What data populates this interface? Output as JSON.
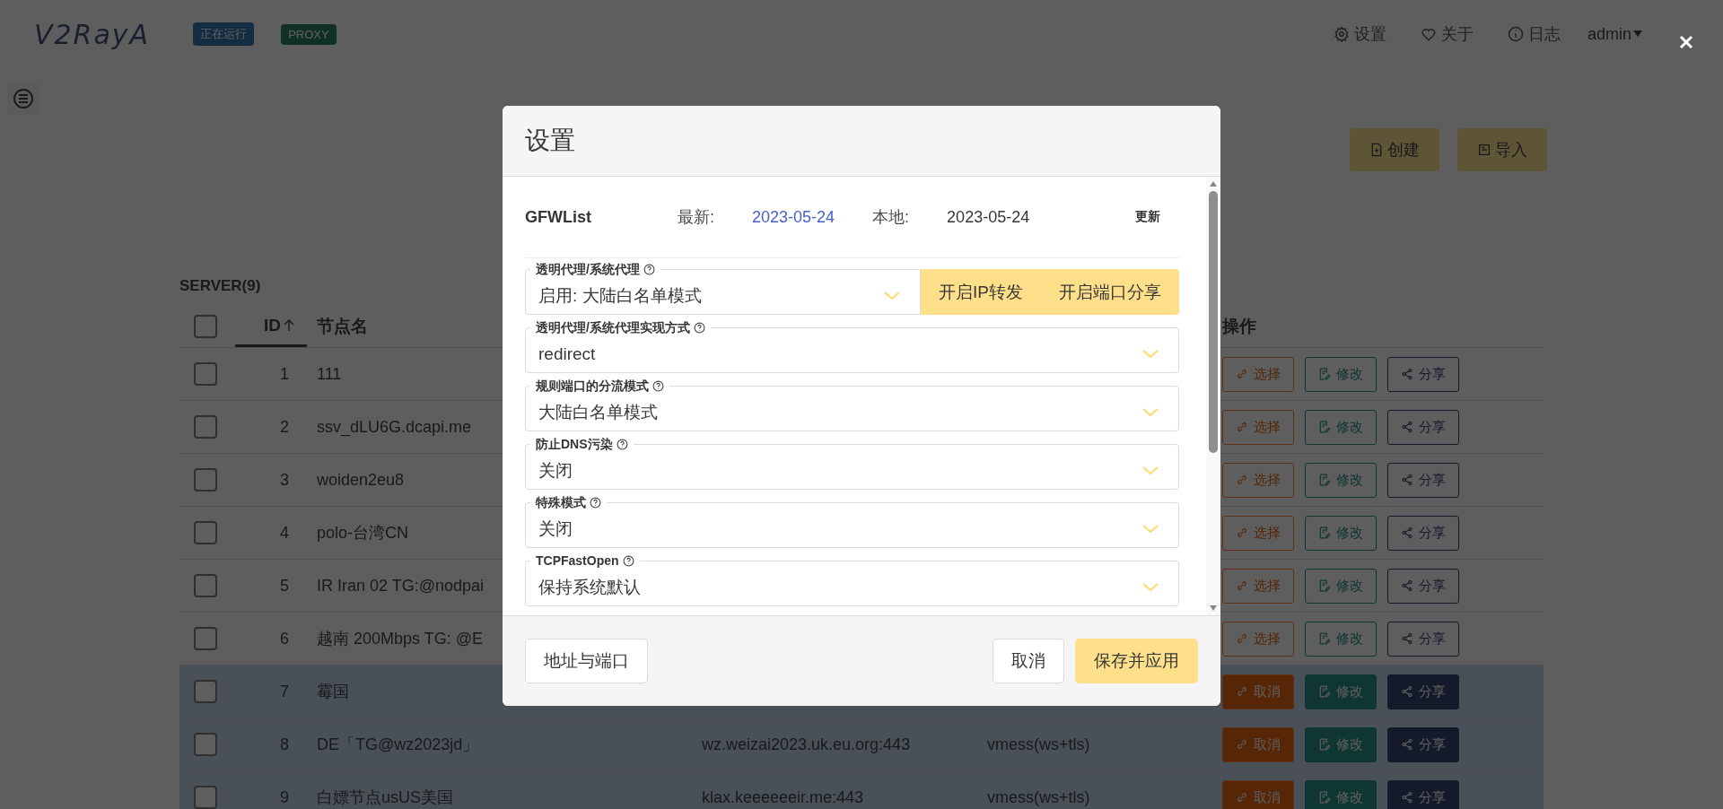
{
  "header": {
    "logo": "V2RayA",
    "badges": [
      {
        "text": "正在运行",
        "kind": "status"
      },
      {
        "text": "PROXY",
        "kind": "mode"
      }
    ],
    "nav": [
      {
        "kind": "settings",
        "label": "设置"
      },
      {
        "kind": "about",
        "label": "关于"
      },
      {
        "kind": "log",
        "label": "日志"
      }
    ],
    "user": "admin"
  },
  "toolbar": [
    {
      "kind": "create",
      "label": "创建"
    },
    {
      "kind": "import",
      "label": "导入"
    }
  ],
  "server_table": {
    "title": "SERVER(9)",
    "columns": {
      "id": "ID",
      "name": "节点名",
      "actions": "操作"
    },
    "sort_ascending": true,
    "all_checked": false,
    "rows": [
      {
        "id": "1",
        "name": "111",
        "checked": false,
        "connected": false,
        "actions": [
          "选择",
          "修改",
          "分享"
        ]
      },
      {
        "id": "2",
        "name": "ssv_dLU6G.dcapi.me",
        "checked": false,
        "connected": false,
        "actions": [
          "选择",
          "修改",
          "分享"
        ]
      },
      {
        "id": "3",
        "name": "woiden2eu8",
        "checked": false,
        "connected": false,
        "actions": [
          "选择",
          "修改",
          "分享"
        ]
      },
      {
        "id": "4",
        "name": "polo-台湾CN",
        "checked": false,
        "connected": false,
        "actions": [
          "选择",
          "修改",
          "分享"
        ]
      },
      {
        "id": "5",
        "name": "IR Iran 02 TG:@nodpai",
        "checked": false,
        "connected": false,
        "actions": [
          "选择",
          "修改",
          "分享"
        ]
      },
      {
        "id": "6",
        "name": "越南 200Mbps TG: @E",
        "checked": false,
        "connected": false,
        "actions": [
          "选择",
          "修改",
          "分享"
        ]
      },
      {
        "id": "7",
        "name": "霉国",
        "checked": false,
        "connected": true,
        "actions": [
          "取消",
          "修改",
          "分享"
        ]
      },
      {
        "id": "8",
        "name": "DE「TG@wz2023jd」",
        "address": "wz.weizai2023.uk.eu.org:443",
        "protocol": "vmess(ws+tls)",
        "checked": false,
        "connected": true,
        "actions": [
          "取消",
          "修改",
          "分享"
        ]
      },
      {
        "id": "9",
        "name": "白嫖节点usUS美国",
        "address": "klax.keeeeeeir.me:443",
        "protocol": "vmess(ws+tls)",
        "checked": false,
        "connected": true,
        "actions": [
          "取消",
          "修改",
          "分享"
        ]
      }
    ]
  },
  "modal": {
    "title": "设置",
    "gfwlist": {
      "name": "GFWList",
      "latest_label": "最新:",
      "latest": "2023-05-24",
      "local_label": "本地:",
      "local": "2023-05-24",
      "update": "更新"
    },
    "fields": [
      {
        "label": "透明代理/系统代理",
        "value": "启用: 大陆白名单模式",
        "buttons": [
          "开启IP转发",
          "开启端口分享"
        ]
      },
      {
        "label": "透明代理/系统代理实现方式",
        "value": "redirect"
      },
      {
        "label": "规则端口的分流模式",
        "value": "大陆白名单模式"
      },
      {
        "label": "防止DNS污染",
        "value": "关闭"
      },
      {
        "label": "特殊模式",
        "value": "关闭"
      },
      {
        "label": "TCPFastOpen",
        "value": "保持系统默认"
      }
    ],
    "footer": {
      "address_button": "地址与端口",
      "cancel": "取消",
      "save": "保存并应用"
    }
  }
}
